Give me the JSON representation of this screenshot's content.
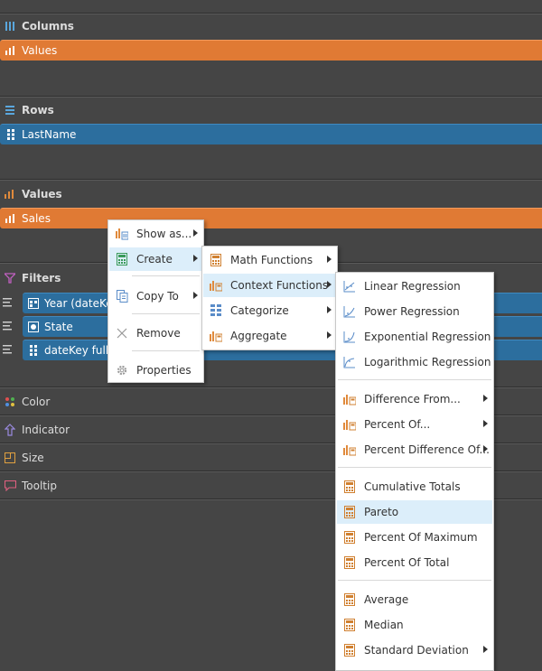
{
  "sections": {
    "columns": {
      "title": "Columns",
      "pill": "Values"
    },
    "rows": {
      "title": "Rows",
      "pill": "LastName"
    },
    "values": {
      "title": "Values",
      "pill": "Sales"
    },
    "filters": {
      "title": "Filters",
      "items": [
        "Year (dateKey",
        "State",
        "dateKey full q"
      ]
    },
    "color": "Color",
    "indicator": "Indicator",
    "size": "Size",
    "tooltip": "Tooltip"
  },
  "menu1": {
    "show_as": "Show as...",
    "create": "Create",
    "copy_to": "Copy To",
    "remove": "Remove",
    "properties": "Properties"
  },
  "menu2": {
    "math": "Math Functions",
    "context": "Context Functions",
    "categorize": "Categorize",
    "aggregate": "Aggregate"
  },
  "menu3": {
    "linear": "Linear Regression",
    "power": "Power Regression",
    "exponential": "Exponential Regression",
    "logarithmic": "Logarithmic Regression",
    "diff_from": "Difference From...",
    "percent_of": "Percent Of...",
    "percent_diff": "Percent Difference Of...",
    "cumulative": "Cumulative Totals",
    "pareto": "Pareto",
    "pct_max": "Percent Of Maximum",
    "pct_total": "Percent Of Total",
    "average": "Average",
    "median": "Median",
    "stdev": "Standard Deviation"
  },
  "colors": {
    "panel": "#454545",
    "orange": "#e07a34",
    "blue": "#2c6e9e",
    "menu_highlight": "#dceefa"
  }
}
